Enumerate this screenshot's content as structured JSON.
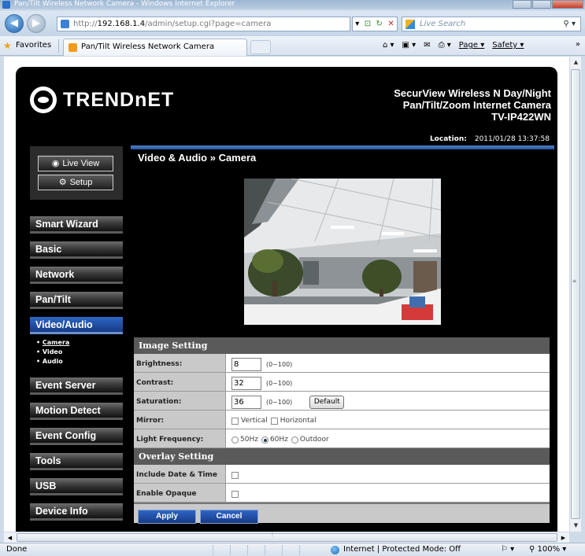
{
  "browser": {
    "window_title": "Pan/Tilt Wireless Network Camera - Windows Internet Explorer",
    "address_prefix": "http://",
    "address_host": "192.168.1.4",
    "address_path": "/admin/setup.cgi?page=camera",
    "search_placeholder": "Live Search",
    "favorites_label": "Favorites",
    "tab_title": "Pan/Tilt Wireless Network Camera",
    "cmd_page": "Page",
    "cmd_safety": "Safety",
    "status_done": "Done",
    "status_zone": "Internet | Protected Mode: Off",
    "zoom": "100%"
  },
  "brand": {
    "name": "TRENDnET",
    "product_line1": "SecurView Wireless N Day/Night",
    "product_line2": "Pan/Tilt/Zoom Internet Camera",
    "model": "TV-IP422WN",
    "location_label": "Location:",
    "location_value": "2011/01/28 13:37:58"
  },
  "nav": {
    "live_view": "Live View",
    "setup": "Setup",
    "menu": [
      "Smart Wizard",
      "Basic",
      "Network",
      "Pan/Tilt",
      "Video/Audio",
      "Event Server",
      "Motion Detect",
      "Event Config",
      "Tools",
      "USB",
      "Device Info"
    ],
    "submenu": [
      "Camera",
      "Video",
      "Audio"
    ]
  },
  "page": {
    "heading": "Video & Audio » Camera",
    "image_setting_title": "Image Setting",
    "brightness_label": "Brightness:",
    "brightness_value": "8",
    "contrast_label": "Contrast:",
    "contrast_value": "32",
    "saturation_label": "Saturation:",
    "saturation_value": "36",
    "range_text": "(0~100)",
    "default_button": "Default",
    "mirror_label": "Mirror:",
    "mirror_vertical": "Vertical",
    "mirror_horizontal": "Horizontal",
    "light_frequency_label": "Light Frequency:",
    "freq_50": "50Hz",
    "freq_60": "60Hz",
    "freq_outdoor": "Outdoor",
    "overlay_setting_title": "Overlay Setting",
    "include_date_time_label": "Include Date & Time",
    "enable_opaque_label": "Enable Opaque",
    "apply_button": "Apply",
    "cancel_button": "Cancel"
  }
}
